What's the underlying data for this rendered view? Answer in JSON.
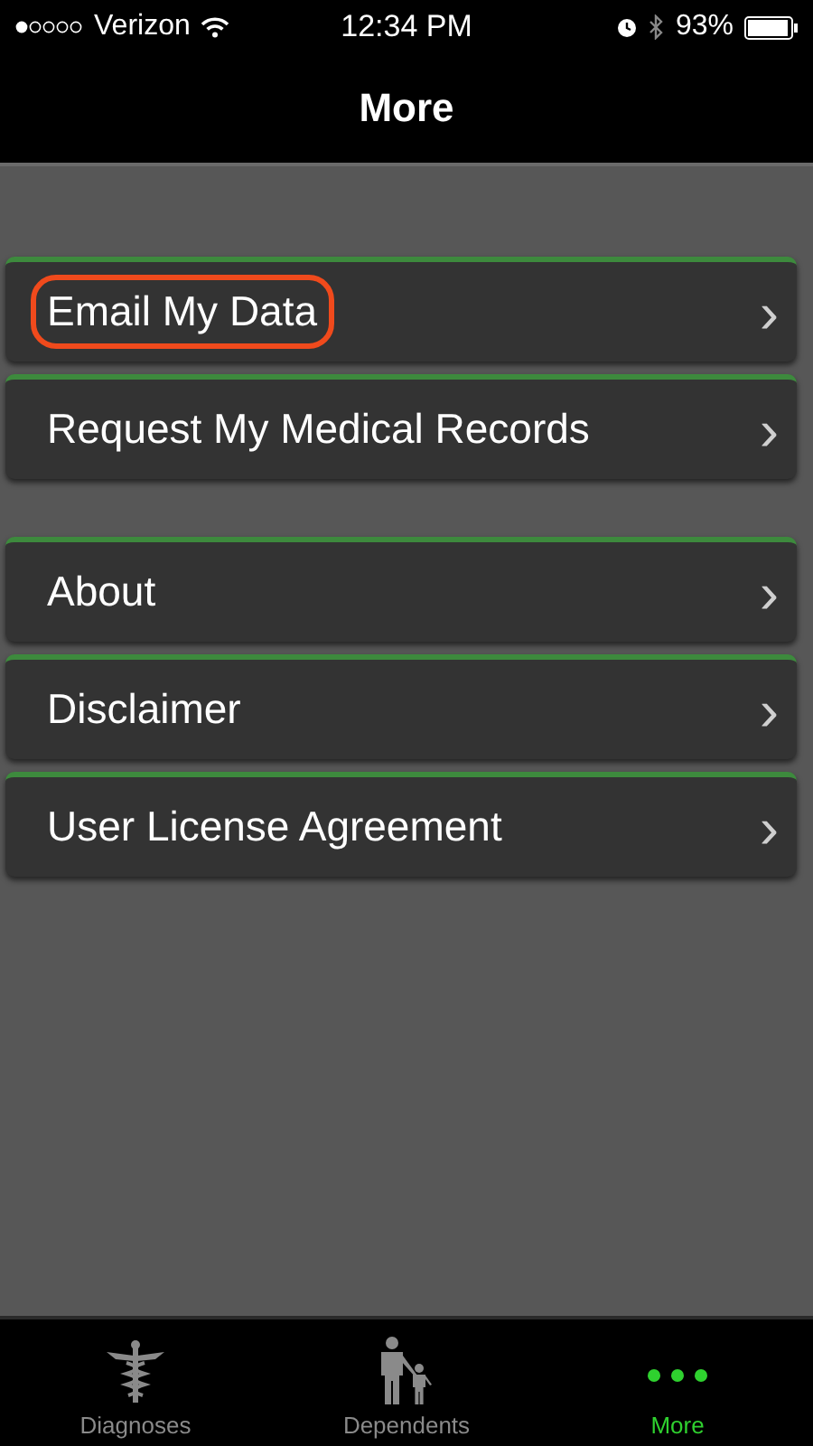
{
  "status_bar": {
    "carrier": "Verizon",
    "time": "12:34 PM",
    "battery": "93%"
  },
  "nav_bar": {
    "title": "More"
  },
  "menu_groups": [
    {
      "items": [
        {
          "label": "Email My Data",
          "chevron": "›",
          "highlighted": true
        },
        {
          "label": "Request My Medical Records",
          "chevron": "›",
          "highlighted": false
        }
      ]
    },
    {
      "items": [
        {
          "label": "About",
          "chevron": "›",
          "highlighted": false
        },
        {
          "label": "Disclaimer",
          "chevron": "›",
          "highlighted": false
        },
        {
          "label": "User License Agreement",
          "chevron": "›",
          "highlighted": false
        }
      ]
    }
  ],
  "tab_bar": [
    {
      "label": "Diagnoses",
      "kind": "caduceus",
      "selected": false
    },
    {
      "label": "Dependents",
      "kind": "family",
      "selected": false
    },
    {
      "label": "More",
      "kind": "dots",
      "selected": true
    }
  ]
}
